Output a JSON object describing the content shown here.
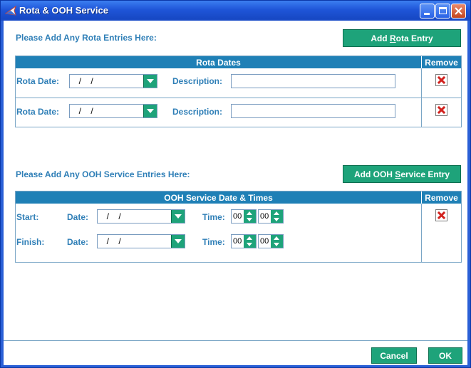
{
  "window": {
    "title": "Rota & OOH Service"
  },
  "rota": {
    "prompt": "Please Add Any Rota Entries Here:",
    "add_pre": "Add ",
    "add_u": "R",
    "add_post": "ota Entry",
    "header_dates": "Rota Dates",
    "header_remove": "Remove",
    "rows": [
      {
        "date_label": "Rota Date:",
        "date_value": "  /    /",
        "desc_label": "Description:",
        "desc_value": ""
      },
      {
        "date_label": "Rota Date:",
        "date_value": "  /    /",
        "desc_label": "Description:",
        "desc_value": ""
      }
    ]
  },
  "ooh": {
    "prompt": "Please Add Any OOH Service Entries Here:",
    "add_pre": "Add OOH ",
    "add_u": "S",
    "add_post": "ervice Entry",
    "header_dates": "OOH Service Date & Times",
    "header_remove": "Remove",
    "start": {
      "label": "Start:",
      "date_label": "Date:",
      "date_value": "  /    /",
      "time_label": "Time:",
      "hour": "00",
      "minute": "00"
    },
    "finish": {
      "label": "Finish:",
      "date_label": "Date:",
      "date_value": "  /    /",
      "time_label": "Time:",
      "hour": "00",
      "minute": "00"
    }
  },
  "footer": {
    "cancel": "Cancel",
    "ok": "OK"
  }
}
